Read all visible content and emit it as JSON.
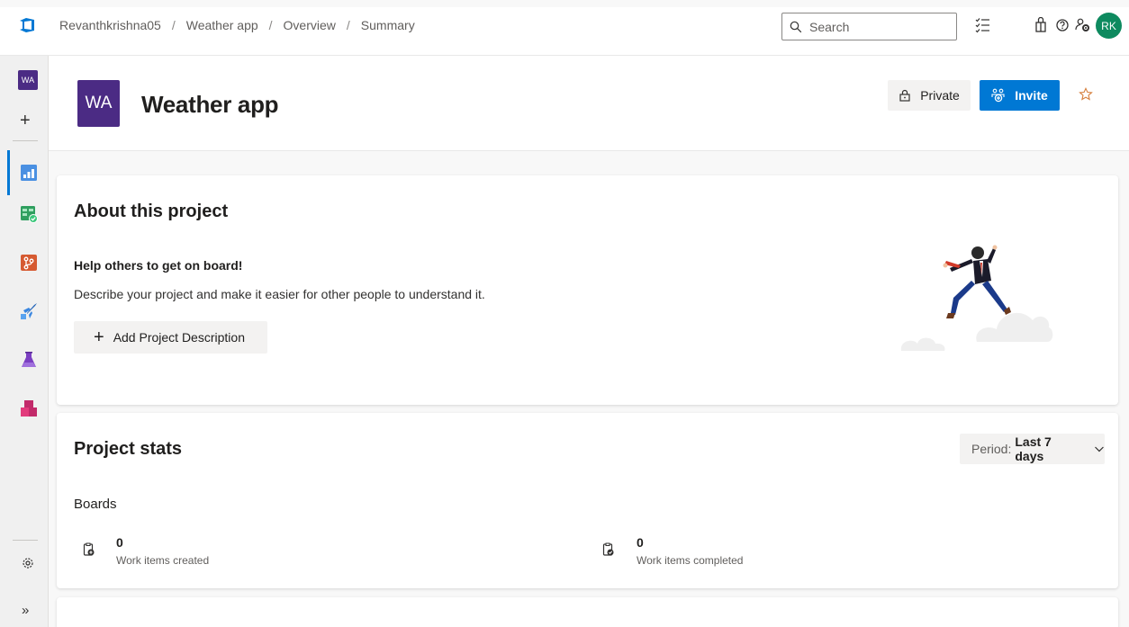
{
  "breadcrumb": [
    "Revanthkrishna05",
    "Weather app",
    "Overview",
    "Summary"
  ],
  "search": {
    "placeholder": "Search"
  },
  "user": {
    "initials": "RK"
  },
  "rail": {
    "project_initials": "WA"
  },
  "project": {
    "initials": "WA",
    "title": "Weather app",
    "private_label": "Private",
    "invite_label": "Invite"
  },
  "about": {
    "heading": "About this project",
    "help_title": "Help others to get on board!",
    "help_desc": "Describe your project and make it easier for other people to understand it.",
    "add_label": "Add Project Description"
  },
  "stats": {
    "heading": "Project stats",
    "period_prefix": "Period:",
    "period_value": "Last 7 days",
    "section": "Boards",
    "items": [
      {
        "value": "0",
        "label": "Work items created"
      },
      {
        "value": "0",
        "label": "Work items completed"
      }
    ]
  },
  "colors": {
    "accent": "#0078d4",
    "project": "#4b2b84",
    "avatar": "#0e8a5f",
    "star": "#d67f3c"
  }
}
